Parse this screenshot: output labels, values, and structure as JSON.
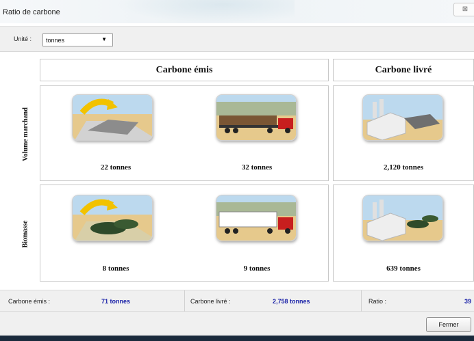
{
  "window": {
    "title": "Ratio de carbone",
    "close_symbol": "⊠"
  },
  "toolbar": {
    "unit_label": "Unité :",
    "unit_value": "tonnes",
    "unit_arrow": "▼"
  },
  "columns": {
    "emitted": "Carbone émis",
    "delivered": "Carbone livré"
  },
  "rows": [
    {
      "label": "Volume marchand",
      "emitted_harvest": "22 tonnes",
      "emitted_transport": "32 tonnes",
      "delivered": "2,120 tonnes"
    },
    {
      "label": "Biomasse",
      "emitted_harvest": "8 tonnes",
      "emitted_transport": "9 tonnes",
      "delivered": "639 tonnes"
    }
  ],
  "summary": {
    "emitted_label": "Carbone émis :",
    "emitted_value": "71 tonnes",
    "delivered_label": "Carbone livré :",
    "delivered_value": "2,758 tonnes",
    "ratio_label": "Ratio :",
    "ratio_value": "39"
  },
  "buttons": {
    "close_label": "Fermer"
  },
  "colors": {
    "value_blue": "#1a22a8",
    "arrow_yellow": "#f2c200",
    "truck_red": "#c81e1e",
    "sky": "#bcd9ee",
    "ground": "#e6c98c"
  }
}
